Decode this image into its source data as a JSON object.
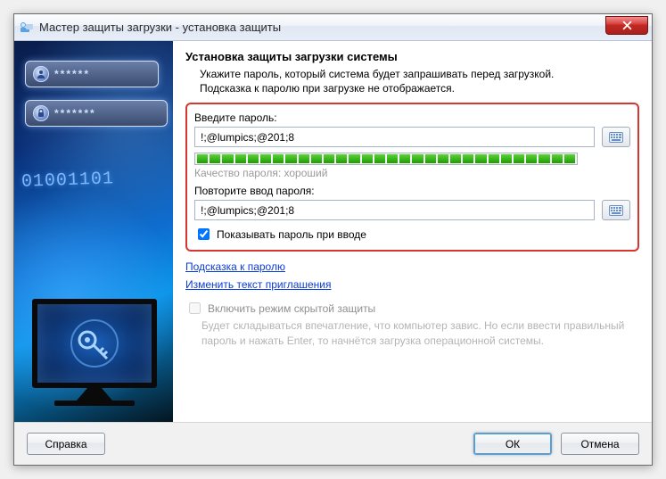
{
  "window": {
    "title": "Мастер защиты загрузки - установка защиты"
  },
  "content": {
    "heading": "Установка защиты загрузки системы",
    "intro_line1": "Укажите пароль, который система будет запрашивать перед загрузкой.",
    "intro_line2": "Подсказка к паролю при загрузке не отображается.",
    "password_label": "Введите пароль:",
    "password_value": "!;@lumpics;@201;8",
    "quality_label": "Качество пароля: хороший",
    "confirm_label": "Повторите ввод пароля:",
    "confirm_value": "!;@lumpics;@201;8",
    "show_password_label": "Показывать пароль при вводе",
    "link_hint": "Подсказка к паролю",
    "link_edit_prompt": "Изменить текст приглашения",
    "hidden_mode_label": "Включить режим скрытой защиты",
    "hidden_mode_desc": "Будет складываться впечатление, что компьютер завис. Но если ввести правильный пароль и нажать Enter, то начнётся загрузка операционной системы."
  },
  "footer": {
    "help": "Справка",
    "ok": "ОК",
    "cancel": "Отмена"
  },
  "decor": {
    "binary": "01001101"
  }
}
